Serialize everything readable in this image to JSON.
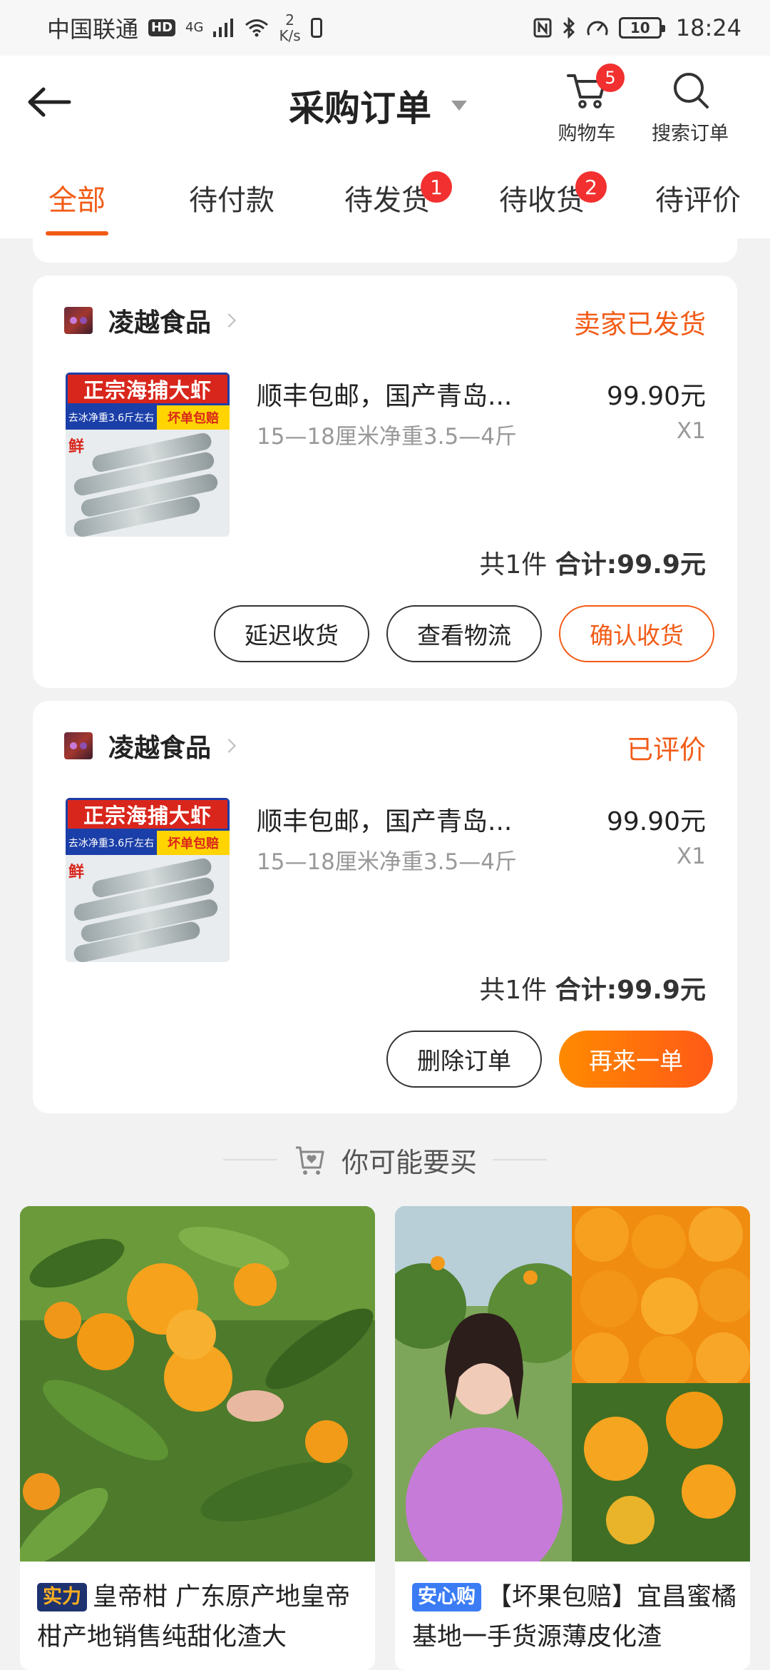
{
  "status_bar": {
    "carrier": "中国联通",
    "hd": "HD",
    "signal": "4G",
    "net_speed": "2",
    "net_unit": "K/s",
    "battery": "10",
    "time": "18:24"
  },
  "header": {
    "title": "采购订单",
    "cart_label": "购物车",
    "cart_badge": "5",
    "search_label": "搜索订单"
  },
  "tabs": [
    {
      "label": "全部",
      "active": true
    },
    {
      "label": "待付款"
    },
    {
      "label": "待发货",
      "badge": "1"
    },
    {
      "label": "待收货",
      "badge": "2"
    },
    {
      "label": "待评价"
    }
  ],
  "orders": [
    {
      "shop": "凌越食品",
      "status": "卖家已发货",
      "thumb_title": "正宗海捕大虾",
      "thumb_sub": "去冰净重3.6斤左右",
      "thumb_tag": "坏单包赔",
      "thumb_fresh": "鲜",
      "title": "顺丰包邮，国产青岛...",
      "spec": "15—18厘米净重3.5—4斤",
      "price": "99.90元",
      "qty": "X1",
      "count": "共1件",
      "total": "合计:99.9元",
      "buttons": [
        "延迟收货",
        "查看物流",
        "确认收货"
      ]
    },
    {
      "shop": "凌越食品",
      "status": "已评价",
      "thumb_title": "正宗海捕大虾",
      "thumb_sub": "去冰净重3.6斤左右",
      "thumb_tag": "坏单包赔",
      "thumb_fresh": "鲜",
      "title": "顺丰包邮，国产青岛...",
      "spec": "15—18厘米净重3.5—4斤",
      "price": "99.90元",
      "qty": "X1",
      "count": "共1件",
      "total": "合计:99.9元",
      "buttons": [
        "删除订单",
        "再来一单"
      ]
    }
  ],
  "recommend": {
    "title": "你可能要买",
    "items": [
      {
        "tag": "实力",
        "text": "皇帝柑 广东原产地皇帝柑产地销售纯甜化渣大"
      },
      {
        "tag": "安心购",
        "text": "【坏果包赔】宜昌蜜橘基地一手货源薄皮化渣"
      }
    ]
  },
  "colors": {
    "accent": "#f25b16",
    "badge": "#f23030"
  }
}
